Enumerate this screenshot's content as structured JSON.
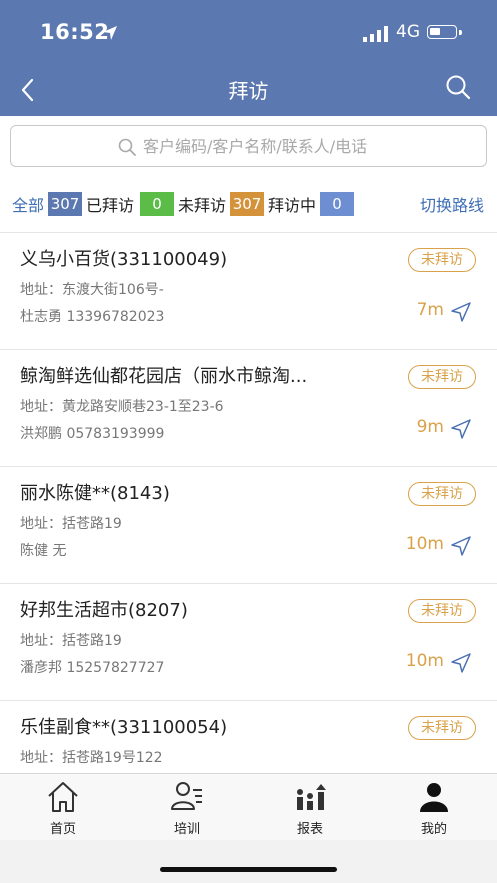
{
  "status": {
    "time": "16:52",
    "network": "4G"
  },
  "header": {
    "title": "拜访"
  },
  "search": {
    "placeholder": "客户编码/客户名称/联系人/电话"
  },
  "filters": {
    "all_label": "全部",
    "all_count": "307",
    "visited_label": "已拜访",
    "visited_count": "0",
    "not_visited_label": "未拜访",
    "not_visited_count": "307",
    "visiting_label": "拜访中",
    "visiting_count": "0",
    "switch_route": "切换路线",
    "colors": {
      "all": "#5b78b0",
      "visited": "#5bbc48",
      "not_visited": "#d4923a",
      "visiting": "#6d8fd1"
    }
  },
  "customers": [
    {
      "name": "义乌小百货(331100049)",
      "address": "地址：东渡大街106号-",
      "contact": "杜志勇 13396782023",
      "status": "未拜访",
      "distance": "7m"
    },
    {
      "name": "鲸淘鲜选仙都花园店（丽水市鲸淘...",
      "address": "地址：黄龙路安顺巷23-1至23-6",
      "contact": "洪郑鹏 05783193999",
      "status": "未拜访",
      "distance": "9m"
    },
    {
      "name": "丽水陈健**(8143)",
      "address": "地址：括苍路19",
      "contact": "陈健 无",
      "status": "未拜访",
      "distance": "10m"
    },
    {
      "name": "好邦生活超市(8207)",
      "address": "地址：括苍路19",
      "contact": "潘彦邦 15257827727",
      "status": "未拜访",
      "distance": "10m"
    },
    {
      "name": "乐佳副食**(331100054)",
      "address": "地址：括苍路19号122",
      "contact": "",
      "status": "未拜访",
      "distance": ""
    }
  ],
  "tabs": [
    {
      "label": "首页",
      "icon": "home-icon"
    },
    {
      "label": "培训",
      "icon": "training-icon"
    },
    {
      "label": "报表",
      "icon": "report-icon"
    },
    {
      "label": "我的",
      "icon": "profile-icon"
    }
  ],
  "accent_color": "#5b78b0",
  "status_color": "#d9a24a"
}
